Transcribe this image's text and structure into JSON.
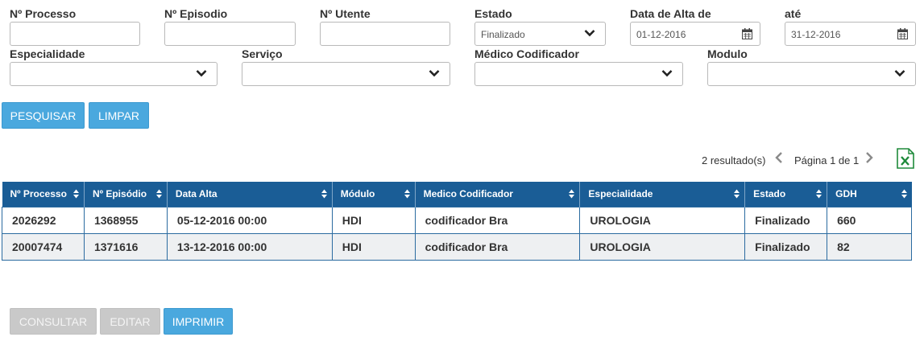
{
  "filters": {
    "processo": {
      "label": "Nº Processo",
      "value": ""
    },
    "episodio": {
      "label": "Nº Episodio",
      "value": ""
    },
    "utente": {
      "label": "Nº Utente",
      "value": ""
    },
    "estado": {
      "label": "Estado",
      "value": "Finalizado"
    },
    "data_alta_de": {
      "label": "Data de Alta de",
      "value": "01-12-2016"
    },
    "ate": {
      "label": "até",
      "value": "31-12-2016"
    },
    "especialidade": {
      "label": "Especialidade",
      "value": ""
    },
    "servico": {
      "label": "Serviço",
      "value": ""
    },
    "medico": {
      "label": "Médico Codificador",
      "value": ""
    },
    "modulo": {
      "label": "Modulo",
      "value": ""
    }
  },
  "actions": {
    "pesquisar": "PESQUISAR",
    "limpar": "LIMPAR"
  },
  "pager": {
    "results": "2 resultado(s)",
    "page": "Página 1 de 1"
  },
  "table": {
    "headers": [
      "Nº Processo",
      "Nº Episódio",
      "Data Alta",
      "Módulo",
      "Medico Codificador",
      "Especialidade",
      "Estado",
      "GDH"
    ],
    "rows": [
      [
        "2026292",
        "1368955",
        "05-12-2016 00:00",
        "HDI",
        "codificador Bra",
        "UROLOGIA",
        "Finalizado",
        "660"
      ],
      [
        "20007474",
        "1371616",
        "13-12-2016 00:00",
        "HDI",
        "codificador Bra",
        "UROLOGIA",
        "Finalizado",
        "82"
      ]
    ]
  },
  "footer": {
    "consultar": "CONSULTAR",
    "editar": "EDITAR",
    "imprimir": "IMPRIMIR"
  },
  "colors": {
    "accent": "#4aa8de",
    "header": "#1a5d96",
    "excel": "#1e8a3a",
    "disabled": "#c9c9c9"
  },
  "icons": {
    "dropdown": "chevron-down-icon",
    "date": "calendar-icon",
    "sort": "sort-icon",
    "export": "excel-icon"
  }
}
